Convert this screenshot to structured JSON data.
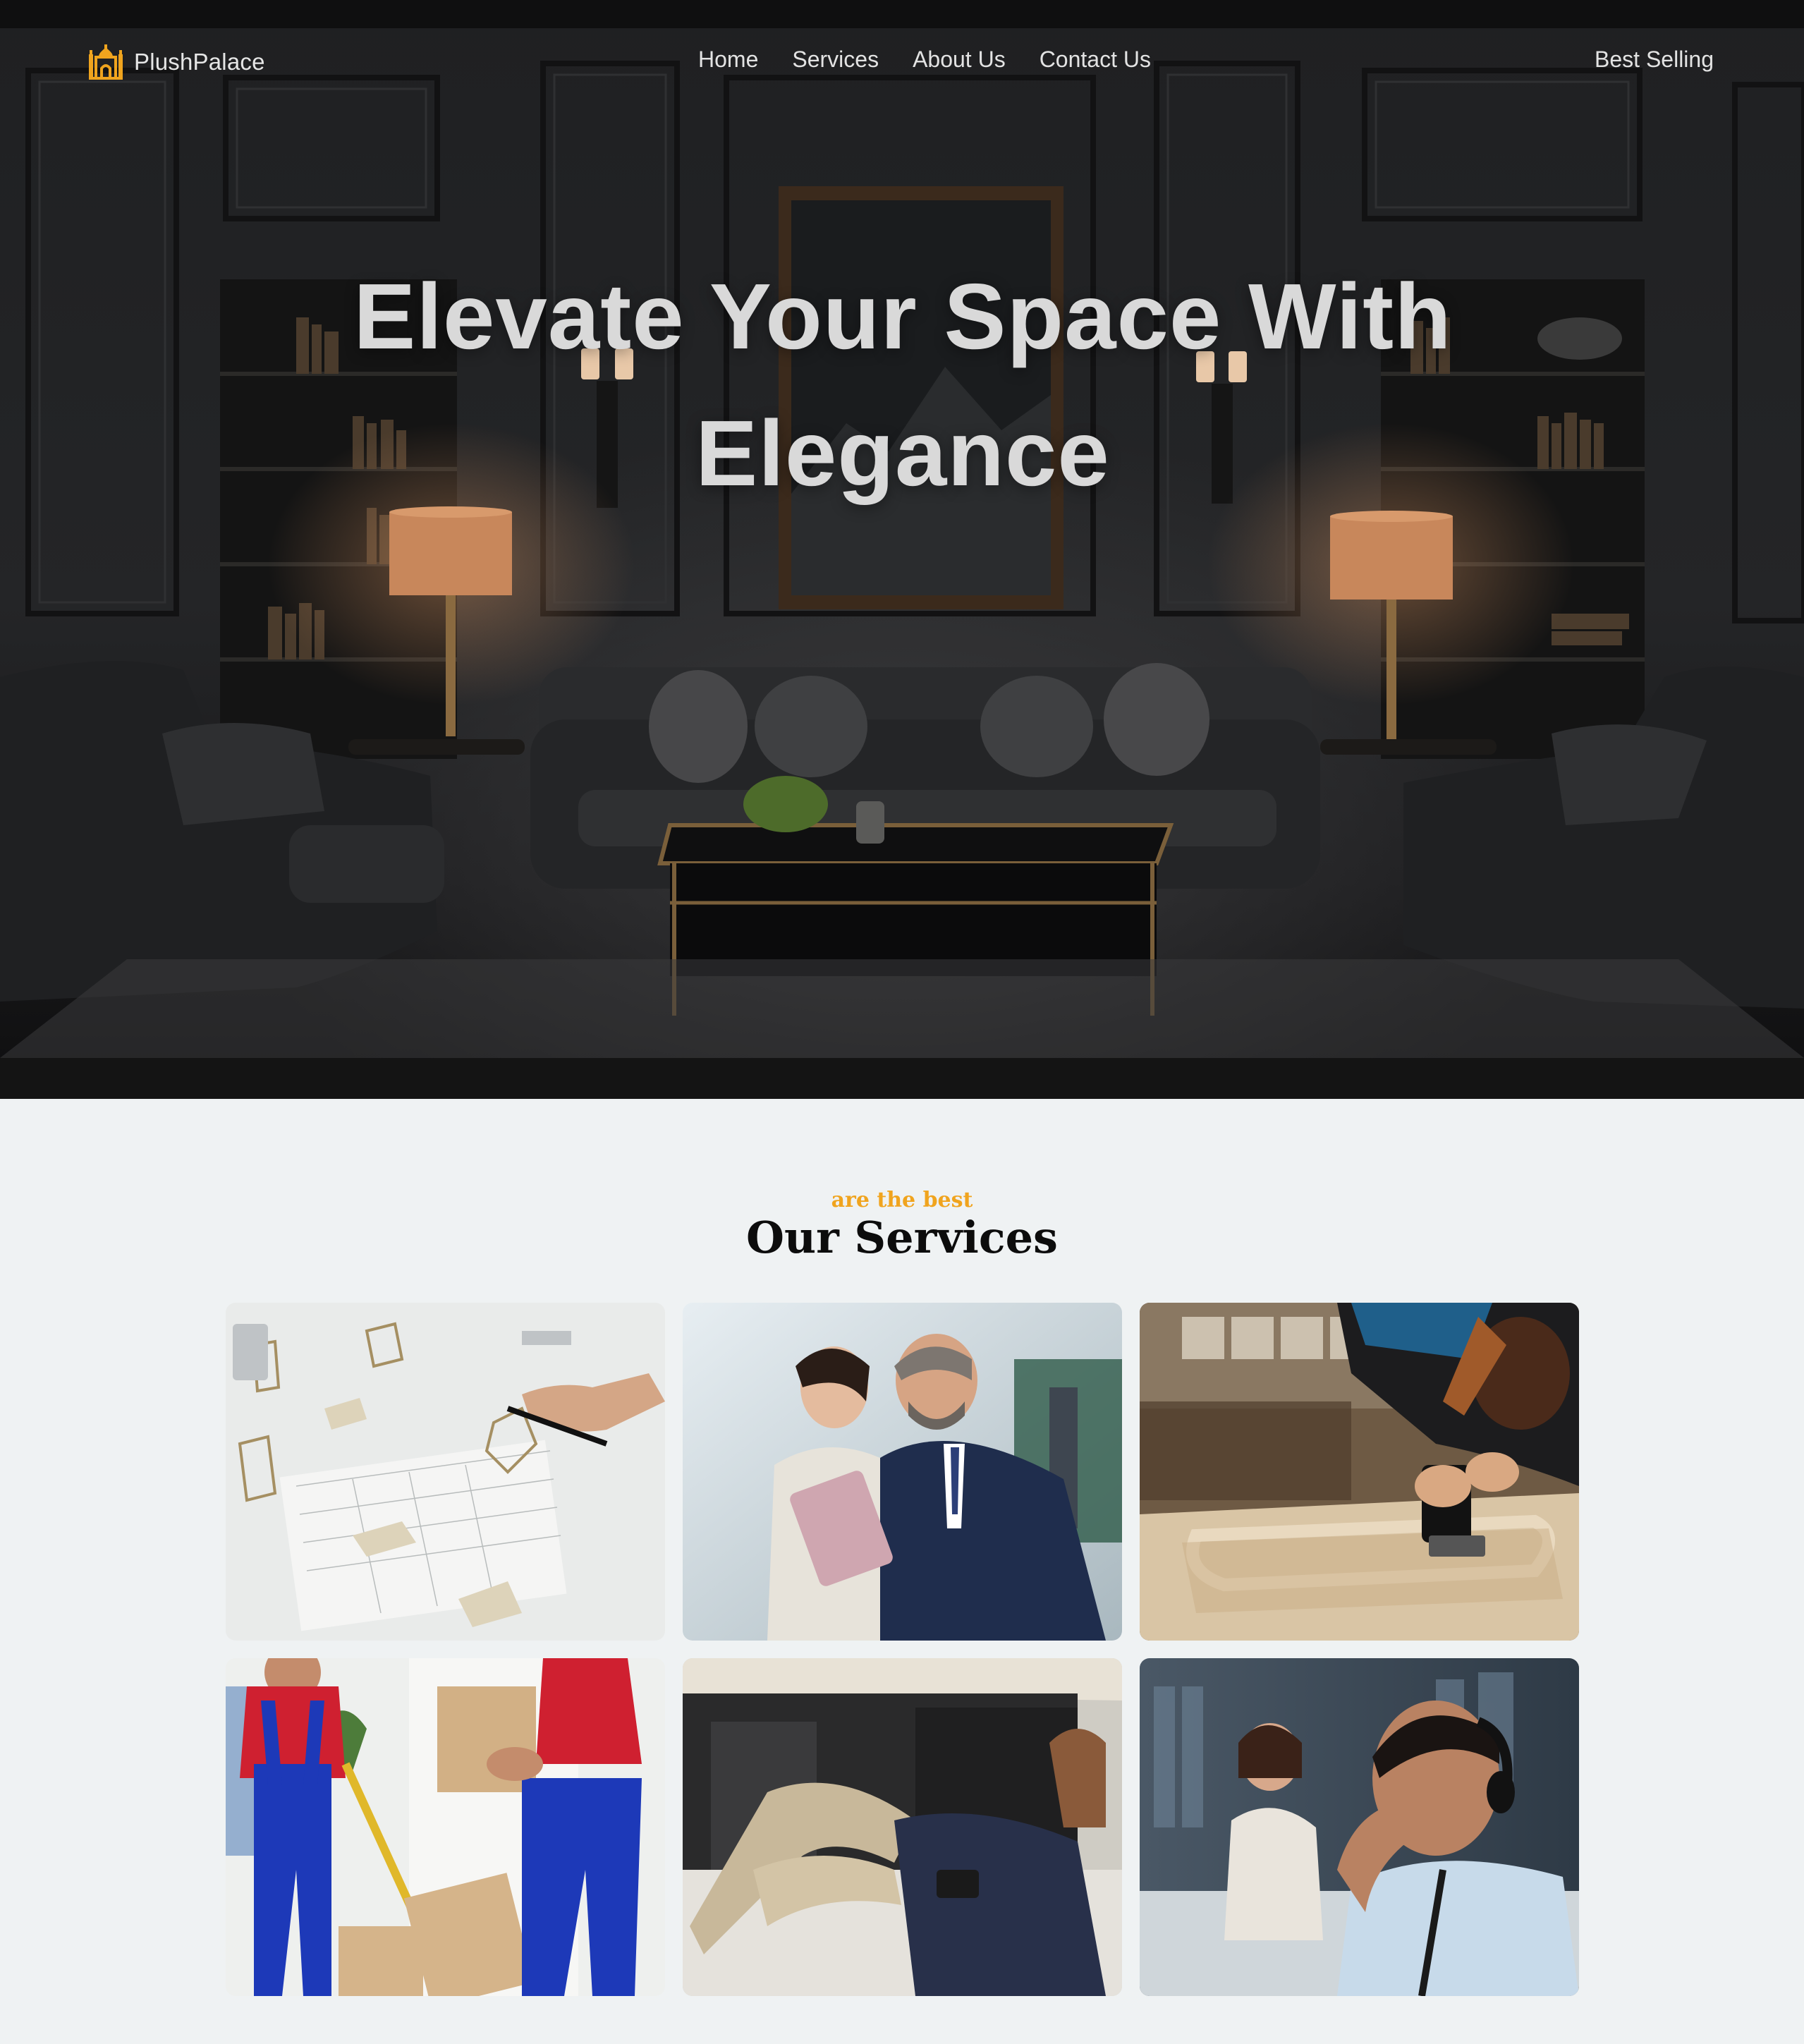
{
  "brand": {
    "name": "PlushPalace",
    "logo_icon": "palace-icon",
    "accent_color": "#f0a41e"
  },
  "nav": {
    "links": [
      "Home",
      "Services",
      "About Us",
      "Contact Us"
    ],
    "cta": "Best Selling"
  },
  "hero": {
    "title_line1": "Elevate Your Space With",
    "title_line2": "Elegance"
  },
  "services": {
    "eyebrow": "are the best",
    "title": "Our Services",
    "cards": [
      {
        "image": "furniture-design-sketch-photo"
      },
      {
        "image": "consultation-meeting-photo"
      },
      {
        "image": "woodworking-craftsman-photo"
      },
      {
        "image": "moving-delivery-photo"
      },
      {
        "image": "repair-installation-photo"
      },
      {
        "image": "customer-support-photo"
      }
    ]
  }
}
